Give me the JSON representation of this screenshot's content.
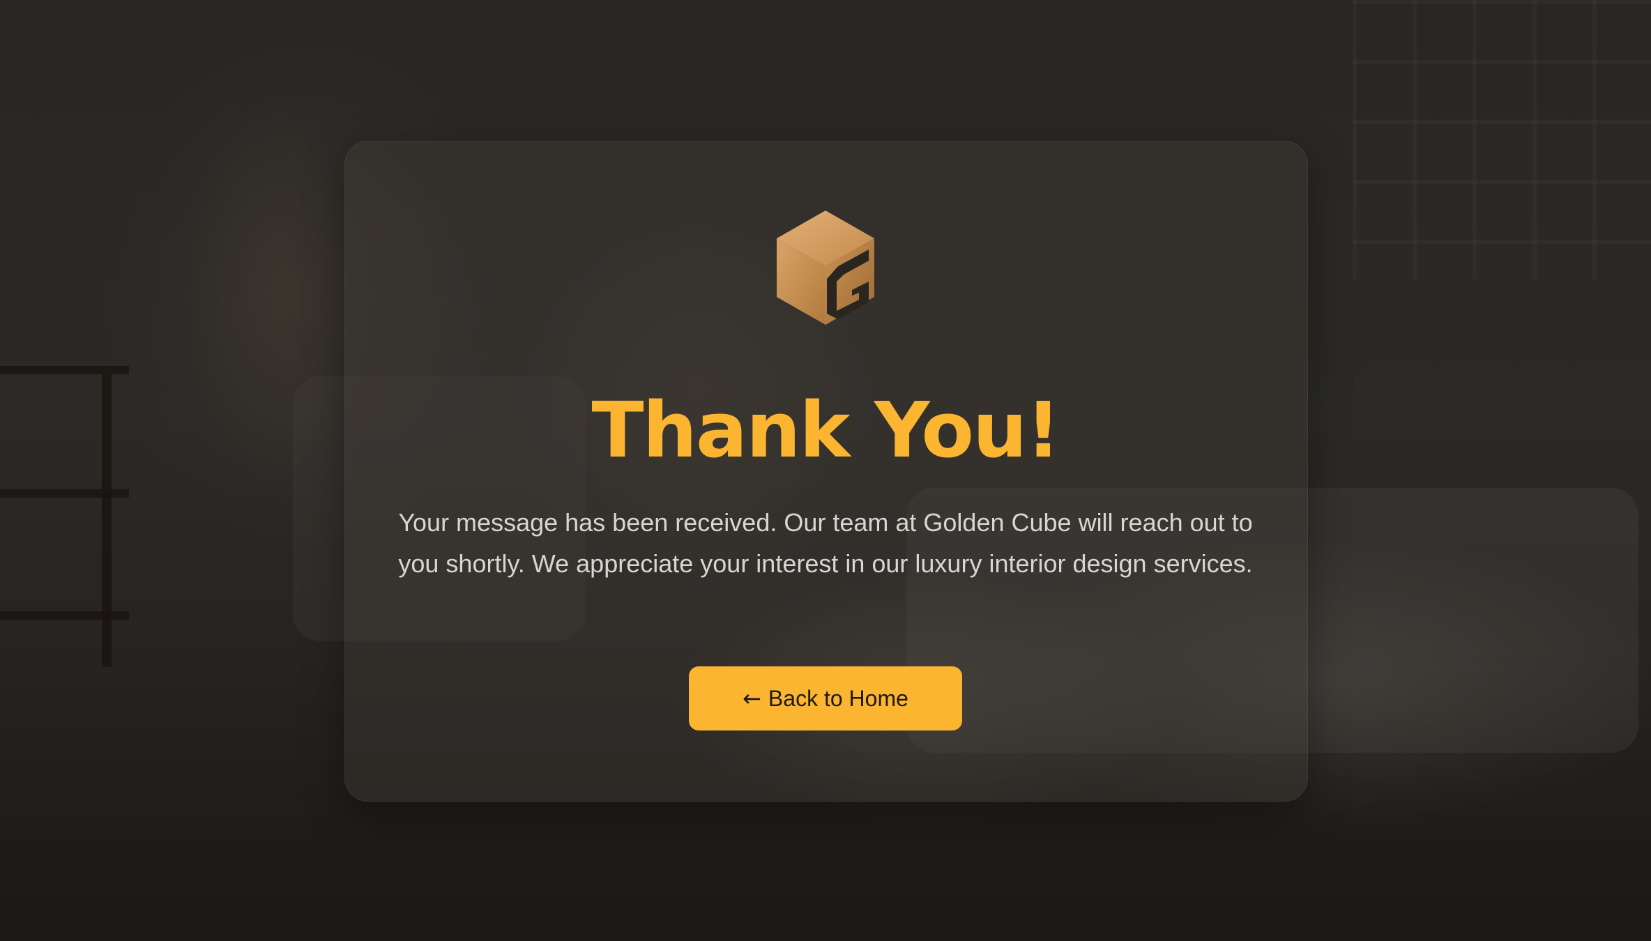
{
  "brand": {
    "logo_icon": "golden-cube-g-icon",
    "accent_color": "#fbb531",
    "logo_color": "#c8914e"
  },
  "confirmation": {
    "title": "Thank You!",
    "message": "Your message has been received. Our team at Golden Cube will reach out to you shortly. We appreciate your interest in our luxury interior design services."
  },
  "actions": {
    "back_home_arrow": "←",
    "back_home_label": "Back to Home"
  }
}
